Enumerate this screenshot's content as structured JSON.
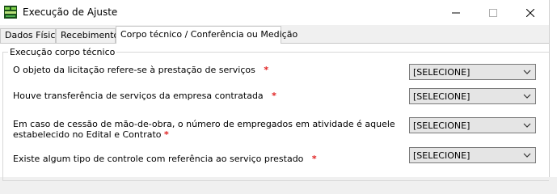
{
  "window": {
    "title": "Execução de Ajuste"
  },
  "tabs": [
    {
      "label": "Dados Físico"
    },
    {
      "label": "Recebimento"
    },
    {
      "label": "Corpo técnico / Conferência ou Medição"
    }
  ],
  "group": {
    "title": "Execução corpo técnico"
  },
  "questions": [
    {
      "label": "O objeto da licitação refere-se à prestação de serviços",
      "required": "*",
      "value": "[SELECIONE]"
    },
    {
      "label": "Houve transferência de serviços da empresa contratada",
      "required": "*",
      "value": "[SELECIONE]"
    },
    {
      "label_line1": "Em caso de cessão de mão-de-obra, o número de empregados em atividade é aquele",
      "label_line2": "estabelecido no Edital e Contrato",
      "required": "*",
      "value": "[SELECIONE]"
    },
    {
      "label": "Existe algum tipo de controle com referência ao serviço prestado",
      "required": "*",
      "value": "[SELECIONE]"
    }
  ]
}
